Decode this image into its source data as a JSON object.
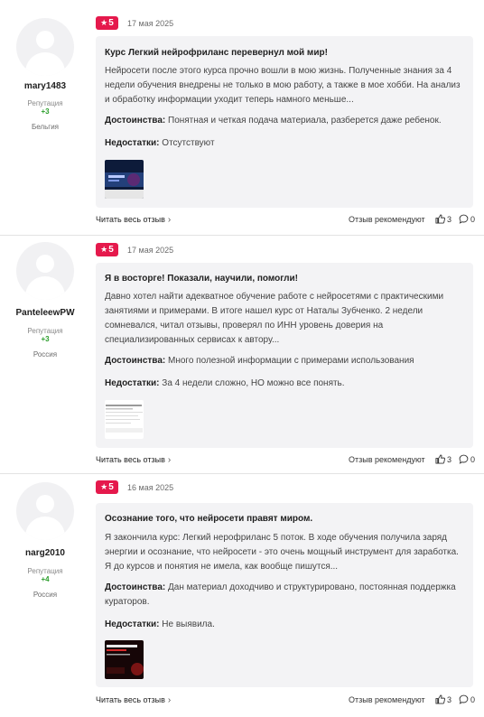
{
  "reviews": [
    {
      "username": "mary1483",
      "reputation_label": "Репутация",
      "reputation_value": "+3",
      "country": "Бельгия",
      "rating": "5",
      "date": "17 мая 2025",
      "title": "Курс Легкий нейрофриланс перевернул мой мир!",
      "text": "Нейросети после этого курса прочно вошли в мою жизнь. Полученные знания за 4 недели обучения внедрены не только в мою работу, а также в мое хобби. На анализ и обработку информации уходит теперь намного меньше...",
      "pros_label": "Достоинства:",
      "pros": "Понятная и четкая подача материала, разберется даже ребенок.",
      "cons_label": "Недостатки:",
      "cons": "Отсутствуют",
      "read_more": "Читать весь отзыв",
      "recommend": "Отзыв рекомендуют",
      "likes": "3",
      "comments": "0"
    },
    {
      "username": "PanteleewPW",
      "reputation_label": "Репутация",
      "reputation_value": "+3",
      "country": "Россия",
      "rating": "5",
      "date": "17 мая 2025",
      "title": "Я в восторге! Показали, научили, помогли!",
      "text": "Давно хотел найти адекватное обучение работе с нейросетями с практическими занятиями и примерами. В итоге нашел курс от Наталы Зубченко. 2 недели сомневался, читал отзывы, проверял по ИНН уровень доверия на специализированных сервисах к автору...",
      "pros_label": "Достоинства:",
      "pros": "Много полезной информации с примерами использования",
      "cons_label": "Недостатки:",
      "cons": "За 4 недели сложно, НО можно все понять.",
      "read_more": "Читать весь отзыв",
      "recommend": "Отзыв рекомендуют",
      "likes": "3",
      "comments": "0"
    },
    {
      "username": "narg2010",
      "reputation_label": "Репутация",
      "reputation_value": "+4",
      "country": "Россия",
      "rating": "5",
      "date": "16 мая 2025",
      "title": "Осознание того, что нейросети правят миром.",
      "text": "Я закончила курс: Легкий нерофриланс 5 поток. В ходе обучения получила заряд энергии и осознание, что нейросети - это очень мощный инструмент для заработка. Я до курсов и понятия не имела, как вообще пишутся...",
      "pros_label": "Достоинства:",
      "pros": "Дан материал доходчиво и структурировано, постоянная поддержка кураторов.",
      "cons_label": "Недостатки:",
      "cons": "Не выявила.",
      "read_more": "Читать весь отзыв",
      "recommend": "Отзыв рекомендуют",
      "likes": "3",
      "comments": "0"
    }
  ],
  "colors": {
    "rating_badge": "#e5194c",
    "reputation_positive": "#2a9d2a",
    "card_bg": "#f3f3f5"
  },
  "icons": [
    "star-icon",
    "chevron-right-icon",
    "thumbs-up-icon",
    "comment-icon"
  ]
}
